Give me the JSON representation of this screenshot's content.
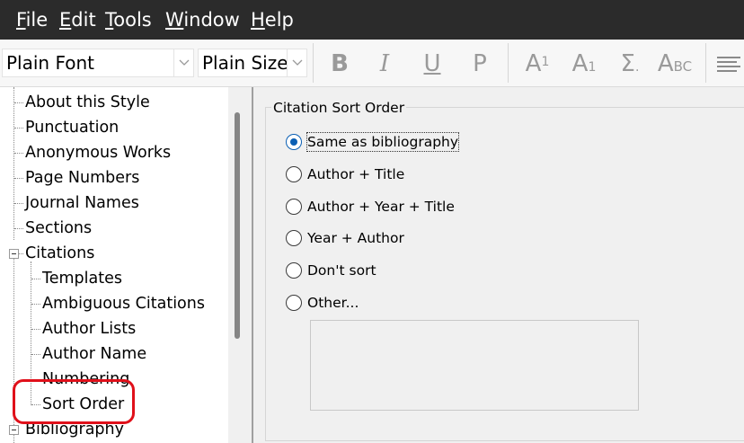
{
  "menubar": {
    "items": [
      {
        "ul": "F",
        "rest": "ile"
      },
      {
        "ul": "E",
        "rest": "dit"
      },
      {
        "ul": "T",
        "rest": "ools"
      },
      {
        "ul": "W",
        "rest": "indow"
      },
      {
        "ul": "H",
        "rest": "elp"
      }
    ]
  },
  "toolbar": {
    "font_value": "Plain Font",
    "size_value": "Plain Size",
    "bold": "B",
    "italic": "I",
    "underline": "U",
    "plain": "P",
    "superscript_base": "A",
    "superscript_mark": "1",
    "subscript_base": "A",
    "subscript_mark": "1",
    "symbol": "Σ",
    "smallcaps_a": "A",
    "smallcaps_rest": "BC"
  },
  "tree": {
    "items": [
      "About this Style",
      "Punctuation",
      "Anonymous Works",
      "Page Numbers",
      "Journal Names",
      "Sections",
      "Citations",
      "Templates",
      "Ambiguous Citations",
      "Author Lists",
      "Author Name",
      "Numbering",
      "Sort Order",
      "Bibliography"
    ]
  },
  "citation_sort": {
    "title": "Citation Sort Order",
    "options": [
      "Same as bibliography",
      "Author + Title",
      "Author + Year + Title",
      "Year + Author",
      "Don't sort",
      "Other..."
    ],
    "selected": "Same as bibliography"
  },
  "colors": {
    "menubar_bg": "#2b2b2b",
    "radio_selected": "#0a5fb4",
    "annotation_circle": "#e0101a"
  }
}
